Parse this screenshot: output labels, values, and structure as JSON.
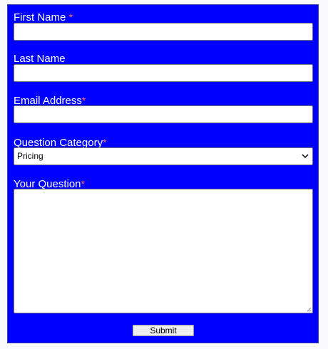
{
  "form": {
    "required_marker": "*",
    "first_name": {
      "label": "First Name ",
      "value": ""
    },
    "last_name": {
      "label": "Last Name",
      "value": ""
    },
    "email": {
      "label": "Email Address",
      "value": ""
    },
    "category": {
      "label": "Question Category",
      "selected": "Pricing"
    },
    "question": {
      "label": "Your Question",
      "value": ""
    },
    "submit_label": "Submit"
  },
  "colors": {
    "panel_background": "#0000ff",
    "label_text": "#ffffff",
    "required_marker": "#ff6b6b",
    "page_background": "#fbfbfd"
  }
}
